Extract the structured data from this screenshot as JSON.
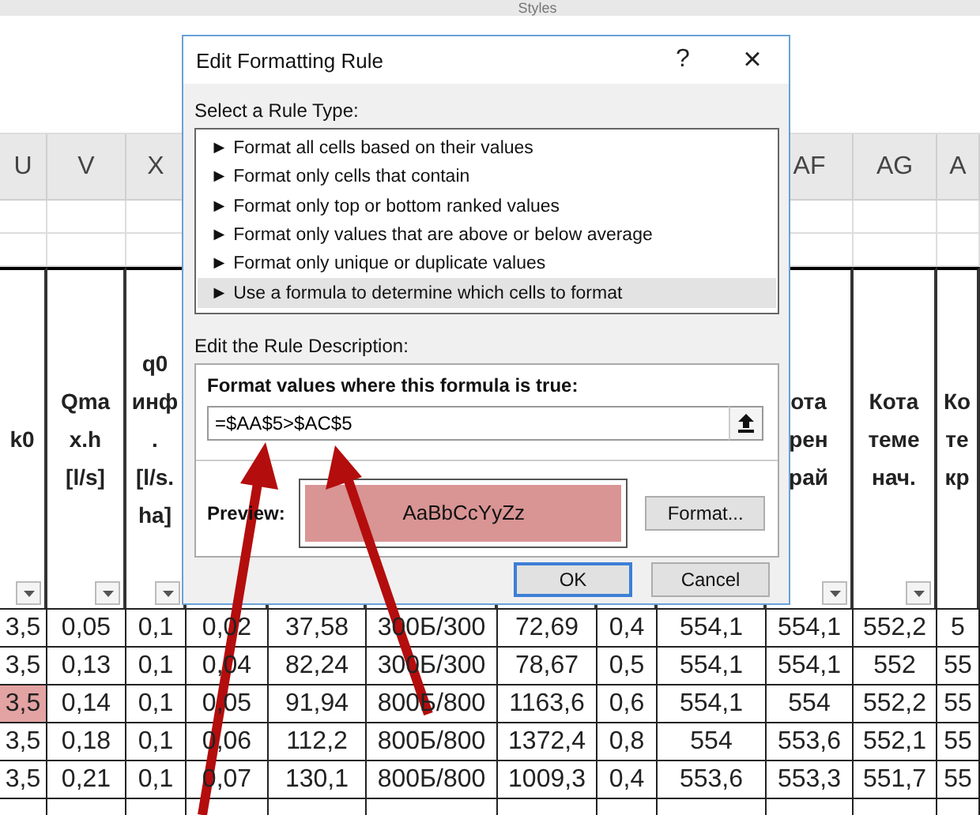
{
  "ribbon": {
    "group_label": "Styles"
  },
  "sheet": {
    "columns": [
      {
        "letter": "U",
        "header": [
          "k0"
        ]
      },
      {
        "letter": "V",
        "header": [
          "Qma",
          "x.h",
          "[l/s]"
        ]
      },
      {
        "letter": "X",
        "header": [
          "q0",
          "инф",
          ".",
          "[l/s.",
          "ha]"
        ]
      },
      {},
      {},
      {},
      {},
      {},
      {},
      {
        "letter": "AF",
        "header": [
          "ота",
          "рен",
          "рай"
        ]
      },
      {
        "letter": "AG",
        "header": [
          "Кота",
          "теме",
          "нач."
        ]
      },
      {
        "letter": "A",
        "header": [
          "Ко",
          "те",
          "кр"
        ]
      }
    ],
    "rows": [
      {
        "first_cell_highlighted": false,
        "cells": [
          "3,5",
          "0,05",
          "0,1",
          "0,02",
          "37,58",
          "300Б/300",
          "72,69",
          "0,4",
          "554,1",
          "554,1",
          "552,2",
          "5"
        ]
      },
      {
        "first_cell_highlighted": false,
        "cells": [
          "3,5",
          "0,13",
          "0,1",
          "0,04",
          "82,24",
          "300Б/300",
          "78,67",
          "0,5",
          "554,1",
          "554,1",
          "552",
          "55"
        ]
      },
      {
        "first_cell_highlighted": true,
        "cells": [
          "3,5",
          "0,14",
          "0,1",
          "0,05",
          "91,94",
          "800Б/800",
          "1163,6",
          "0,6",
          "554,1",
          "554",
          "552,2",
          "55"
        ]
      },
      {
        "first_cell_highlighted": false,
        "cells": [
          "3,5",
          "0,18",
          "0,1",
          "0,06",
          "112,2",
          "800Б/800",
          "1372,4",
          "0,8",
          "554",
          "553,6",
          "552,1",
          "55"
        ]
      },
      {
        "first_cell_highlighted": false,
        "cells": [
          "3,5",
          "0,21",
          "0,1",
          "0,07",
          "130,1",
          "800Б/800",
          "1009,3",
          "0,4",
          "553,6",
          "553,3",
          "551,7",
          "55"
        ]
      }
    ]
  },
  "dialog": {
    "title": "Edit Formatting Rule",
    "help": "?",
    "close": "×",
    "rule_type_label": "Select a Rule Type:",
    "rule_types": [
      {
        "label": "Format all cells based on their values",
        "selected": false
      },
      {
        "label": "Format only cells that contain",
        "selected": false
      },
      {
        "label": "Format only top or bottom ranked values",
        "selected": false
      },
      {
        "label": "Format only values that are above or below average",
        "selected": false
      },
      {
        "label": "Format only unique or duplicate values",
        "selected": false
      },
      {
        "label": "Use a formula to determine which cells to format",
        "selected": true
      }
    ],
    "bullet": "►",
    "description_label": "Edit the Rule Description:",
    "formula_label": "Format values where this formula is true:",
    "formula": "=$AA$5>$AC$5",
    "preview_label": "Preview:",
    "preview_sample": "AaBbCcYyZz",
    "format_button": "Format...",
    "buttons": [
      {
        "label": "OK",
        "default": true
      },
      {
        "label": "Cancel",
        "default": false
      }
    ]
  }
}
